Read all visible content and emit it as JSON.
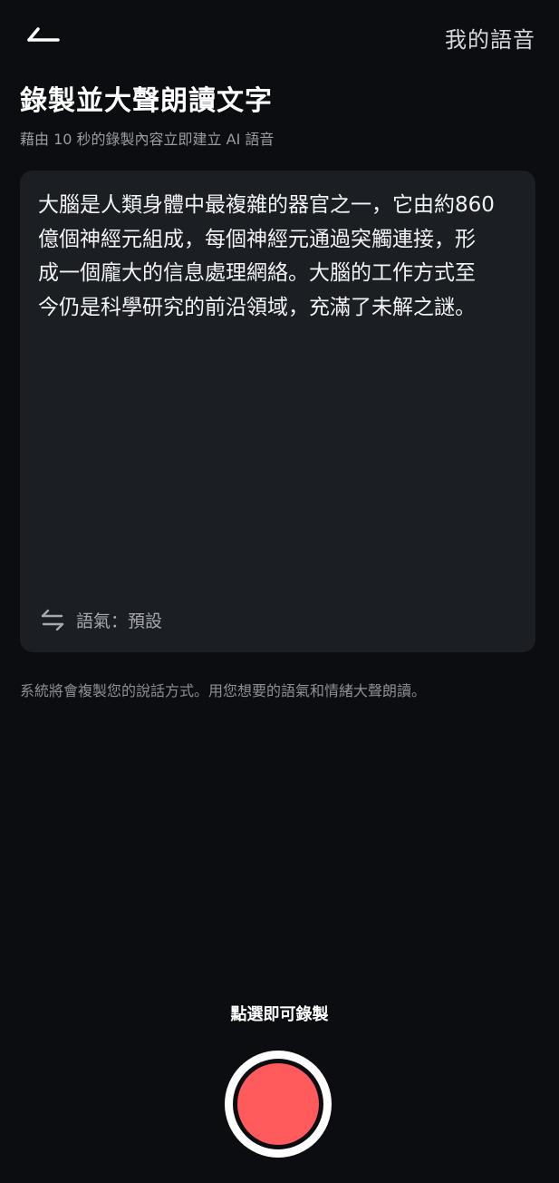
{
  "header": {
    "my_voice_label": "我的語音"
  },
  "page": {
    "title": "錄製並大聲朗讀文字",
    "subtitle": "藉由 10 秒的錄製內容立即建立 AI 語音"
  },
  "script_card": {
    "text": "大腦是人類身體中最複雜的器官之一，它由約860\n億個神經元組成，每個神經元通過突觸連接，形\n成一個龐大的信息處理網絡。大腦的工作方式至\n今仍是科學研究的前沿領域，充滿了未解之謎。",
    "tone_label": "語氣：預設"
  },
  "hint": "系統將會複製您的說話方式。用您想要的語氣和情緒大聲朗讀。",
  "record": {
    "prompt": "點選即可錄製",
    "button_color": "#ff5a5c"
  },
  "icons": {
    "back": "back-arrow-icon",
    "swap": "swap-arrows-icon"
  },
  "colors": {
    "background": "#0b0d10",
    "card": "#1b1e22",
    "accent": "#ff5a5c"
  }
}
